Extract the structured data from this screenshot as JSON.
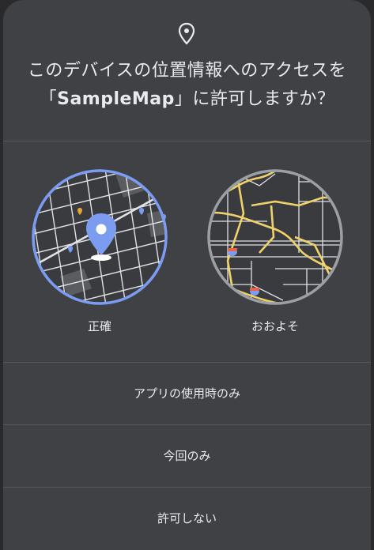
{
  "dialog": {
    "title_prefix": "このデバイスの位置情報へのアクセスを「",
    "app_name": "SampleMap",
    "title_suffix": "」に許可しますか？",
    "icon": "location-pin-icon"
  },
  "options": [
    {
      "label": "正確",
      "icon": "precise-location-map-icon",
      "selected": true
    },
    {
      "label": "おおよそ",
      "icon": "approximate-location-map-icon",
      "selected": false
    }
  ],
  "actions": {
    "while_using": "アプリの使用時のみ",
    "only_this_time": "今回のみ",
    "deny": "許可しない"
  },
  "colors": {
    "dialog_bg": "#404145",
    "text": "#e8eaed",
    "accent": "#7b9cf0",
    "approx_ring": "#9aa0a6",
    "road_yellow": "#f1d26a"
  }
}
